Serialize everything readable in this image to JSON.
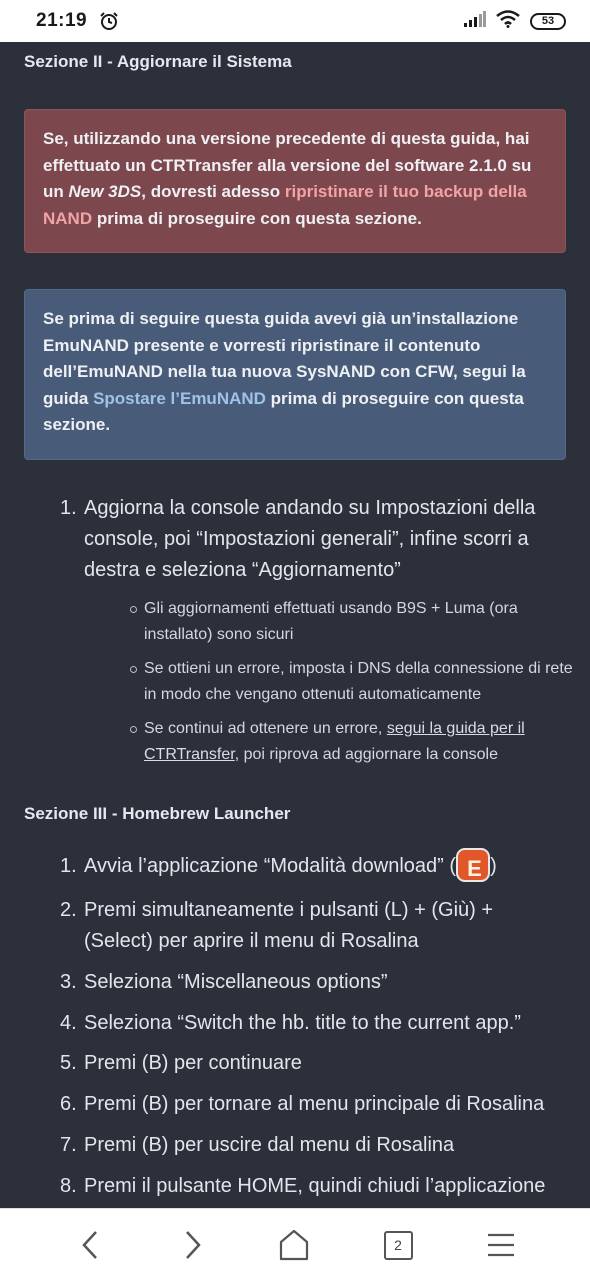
{
  "status_bar": {
    "time": "21:19",
    "battery": "53"
  },
  "section2": {
    "heading": "Sezione II - Aggiornare il Sistema",
    "red_callout": {
      "text_1": "Se, utilizzando una versione precedente di questa guida, hai effettuato un CTRTransfer alla versione del software 2.1.0 su un ",
      "italic": "New 3DS",
      "text_2": ", dovresti adesso ",
      "link": "ripristinare il tuo backup della NAND",
      "text_3": " prima di proseguire con questa sezione."
    },
    "blue_callout": {
      "text_1": "Se prima di seguire questa guida avevi già un’installazione EmuNAND presente e vorresti ripristinare il contenuto dell’EmuNAND nella tua nuova SysNAND con CFW, segui la guida ",
      "link": "Spostare l’EmuNAND",
      "text_2": " prima di proseguire con questa sezione."
    },
    "step1": {
      "number": "1.",
      "text": "Aggiorna la console andando su Impostazioni della console, poi “Impostazioni generali”, infine scorri a destra e seleziona “Aggiornamento”",
      "bullets": [
        "Gli aggiornamenti effettuati usando B9S + Luma (ora installato) sono sicuri",
        "Se ottieni un errore, imposta i DNS della connessione di rete in modo che vengano ottenuti automaticamente"
      ],
      "bullet3_pre": "Se continui ad ottenere un errore, ",
      "bullet3_link": "segui la guida per il CTRTransfer",
      "bullet3_post": ", poi riprova ad aggiornare la console"
    }
  },
  "section3": {
    "heading": "Sezione III - Homebrew Launcher",
    "steps": [
      {
        "number": "1.",
        "text": "Avvia l’applicazione “Modalità download” ("
      },
      {
        "number": "2.",
        "text": "Premi simultaneamente i pulsanti (L) + (Giù) + (Select) per aprire il menu di Rosalina"
      },
      {
        "number": "3.",
        "text": "Seleziona “Miscellaneous options”"
      },
      {
        "number": "4.",
        "text": "Seleziona “Switch the hb. title to the current app.”"
      },
      {
        "number": "5.",
        "text": "Premi (B) per continuare"
      },
      {
        "number": "6.",
        "text": "Premi (B) per tornare al menu principale di Rosalina"
      },
      {
        "number": "7.",
        "text": "Premi (B) per uscire dal menu di Rosalina"
      },
      {
        "number": "8.",
        "text": "Premi il pulsante HOME, quindi chiudi l’applicazione"
      }
    ],
    "step1_close": ")",
    "app_icon_letter": "E"
  },
  "nav": {
    "tab_count": "2"
  }
}
